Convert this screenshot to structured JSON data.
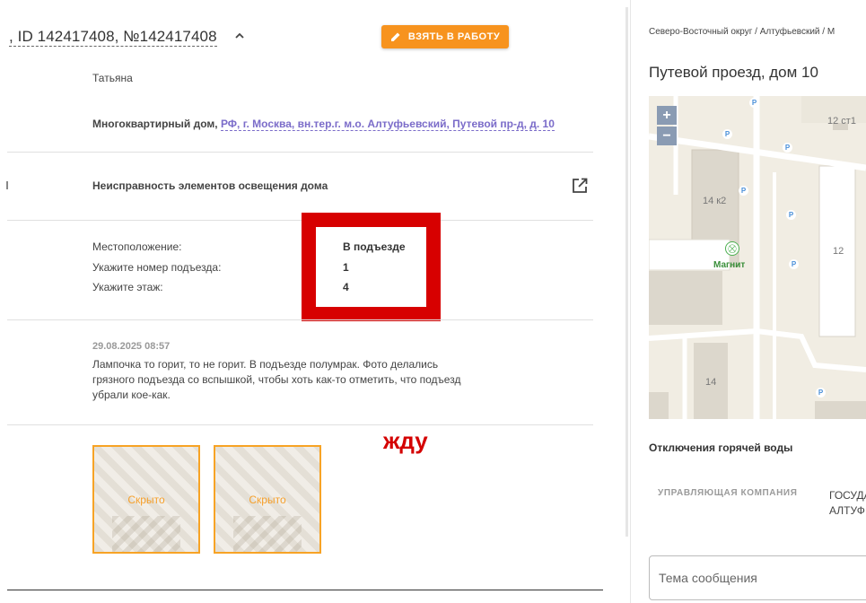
{
  "ticket": {
    "title": ", ID 142417408, №142417408",
    "take_button": "ВЗЯТЬ В РАБОТУ",
    "name": "Татьяна",
    "address_label": "Многоквартирный дом,",
    "address_link": "РФ, г. Москва, вн.тер.г. м.о. Алтуфьевский, Путевой пр-д, д. 10",
    "issue": "Неисправность элементов освещения дома",
    "fields": [
      {
        "label": "Местоположение:",
        "value": "В подъезде"
      },
      {
        "label": "Укажите номер подъезда:",
        "value": "1"
      },
      {
        "label": "Укажите этаж:",
        "value": "4"
      }
    ],
    "comment_date": "29.08.2025 08:57",
    "comment_text": "Лампочка то горит, то не горит. В подъезде полумрак. Фото делались грязного подъезда со вспышкой, чтобы хоть как-то отметить, что подъезд убрали кое-как.",
    "annotation": "жду",
    "photos": [
      {
        "label": "Скрыто"
      },
      {
        "label": "Скрыто"
      }
    ]
  },
  "side": {
    "breadcrumb": "Северо-Восточный округ / Алтуфьевский / М",
    "place_title": "Путевой проезд, дом 10",
    "map": {
      "zoom_in": "+",
      "zoom_out": "−",
      "labels": {
        "b1": "14 к2",
        "b2": "12",
        "b3": "14",
        "b4": "12 ст1",
        "shop": "Магнит",
        "parking": "P"
      }
    },
    "hot_water_title": "Отключения горячей воды",
    "mc_header": "УПРАВЛЯЮЩАЯ КОМПАНИЯ",
    "gos_line1": "ГОСУДА",
    "gos_line2": "АЛТУФ",
    "message_placeholder": "Тема сообщения"
  },
  "colors": {
    "accent": "#f7931e",
    "link": "#7b6cc9",
    "highlight": "#d70000"
  }
}
